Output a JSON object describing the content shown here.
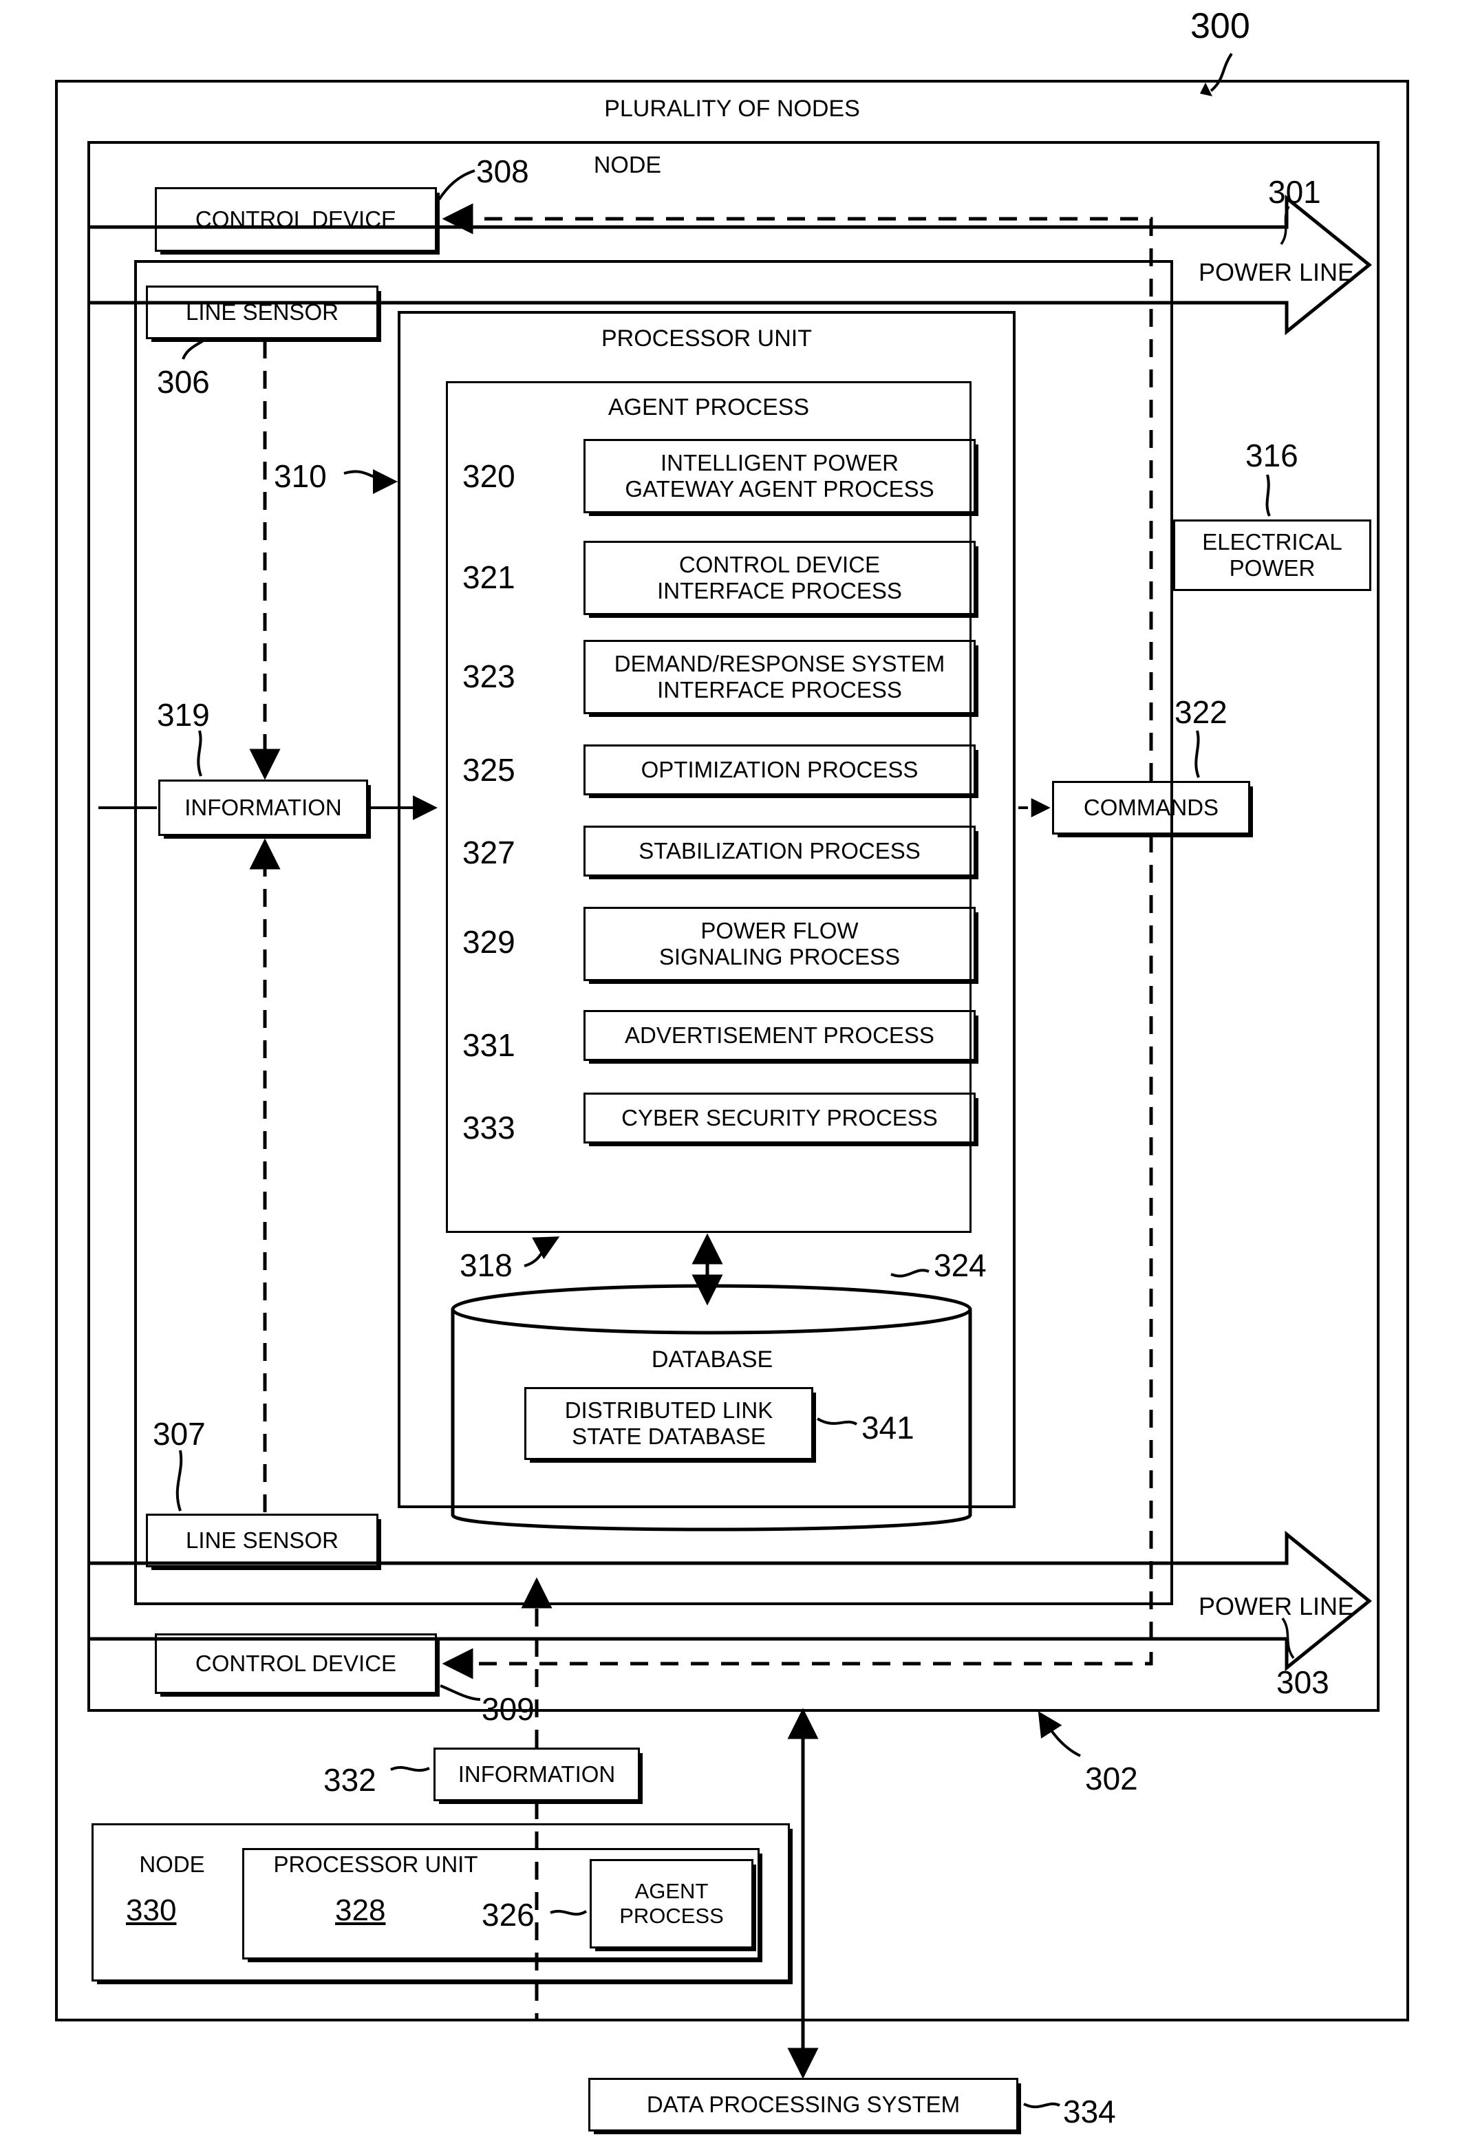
{
  "figure": {
    "ref_number": "300",
    "outer_label": "PLURALITY OF NODES"
  },
  "node": {
    "label": "NODE",
    "ref": "302",
    "control_device_top": {
      "label": "CONTROL DEVICE",
      "ref": "308"
    },
    "control_device_bottom": {
      "label": "CONTROL DEVICE",
      "ref": "309"
    },
    "line_sensor_top": {
      "label": "LINE SENSOR",
      "ref": "306"
    },
    "line_sensor_bottom": {
      "label": "LINE SENSOR",
      "ref": "307"
    },
    "information": {
      "label": "INFORMATION",
      "ref": "319"
    },
    "signal_ref": "310",
    "commands": {
      "label": "COMMANDS",
      "ref": "322"
    },
    "electrical_power": {
      "label": "ELECTRICAL POWER",
      "ref": "316"
    },
    "power_line_top": {
      "label": "POWER LINE",
      "ref": "301"
    },
    "power_line_bottom": {
      "label": "POWER LINE",
      "ref": "303"
    }
  },
  "processor_unit": {
    "label": "PROCESSOR UNIT",
    "agent_process": {
      "label": "AGENT PROCESS",
      "ref": "318",
      "items": [
        {
          "ref": "320",
          "label": "INTELLIGENT POWER\nGATEWAY AGENT PROCESS"
        },
        {
          "ref": "321",
          "label": "CONTROL DEVICE\nINTERFACE PROCESS"
        },
        {
          "ref": "323",
          "label": "DEMAND/RESPONSE SYSTEM\nINTERFACE PROCESS"
        },
        {
          "ref": "325",
          "label": "OPTIMIZATION PROCESS"
        },
        {
          "ref": "327",
          "label": "STABILIZATION PROCESS"
        },
        {
          "ref": "329",
          "label": "POWER FLOW\nSIGNALING PROCESS"
        },
        {
          "ref": "331",
          "label": "ADVERTISEMENT PROCESS"
        },
        {
          "ref": "333",
          "label": "CYBER SECURITY PROCESS"
        }
      ]
    },
    "database": {
      "label": "DATABASE",
      "ref": "324",
      "inner": {
        "label": "DISTRIBUTED LINK\nSTATE DATABASE",
        "ref": "341"
      }
    }
  },
  "second_node": {
    "label": "NODE",
    "ref": "330",
    "processor_unit": {
      "label": "PROCESSOR UNIT",
      "ref": "328"
    },
    "agent_process": {
      "label": "AGENT\nPROCESS",
      "ref": "326"
    },
    "information": {
      "label": "INFORMATION",
      "ref": "332"
    }
  },
  "data_processing_system": {
    "label": "DATA PROCESSING SYSTEM",
    "ref": "334"
  }
}
